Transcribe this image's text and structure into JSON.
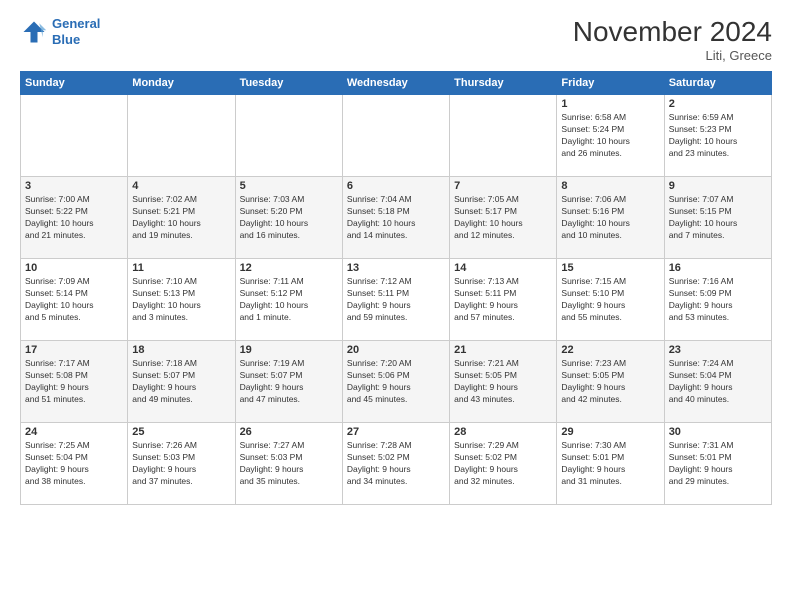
{
  "logo": {
    "line1": "General",
    "line2": "Blue"
  },
  "title": "November 2024",
  "location": "Liti, Greece",
  "days_of_week": [
    "Sunday",
    "Monday",
    "Tuesday",
    "Wednesday",
    "Thursday",
    "Friday",
    "Saturday"
  ],
  "weeks": [
    [
      {
        "day": "",
        "info": ""
      },
      {
        "day": "",
        "info": ""
      },
      {
        "day": "",
        "info": ""
      },
      {
        "day": "",
        "info": ""
      },
      {
        "day": "",
        "info": ""
      },
      {
        "day": "1",
        "info": "Sunrise: 6:58 AM\nSunset: 5:24 PM\nDaylight: 10 hours\nand 26 minutes."
      },
      {
        "day": "2",
        "info": "Sunrise: 6:59 AM\nSunset: 5:23 PM\nDaylight: 10 hours\nand 23 minutes."
      }
    ],
    [
      {
        "day": "3",
        "info": "Sunrise: 7:00 AM\nSunset: 5:22 PM\nDaylight: 10 hours\nand 21 minutes."
      },
      {
        "day": "4",
        "info": "Sunrise: 7:02 AM\nSunset: 5:21 PM\nDaylight: 10 hours\nand 19 minutes."
      },
      {
        "day": "5",
        "info": "Sunrise: 7:03 AM\nSunset: 5:20 PM\nDaylight: 10 hours\nand 16 minutes."
      },
      {
        "day": "6",
        "info": "Sunrise: 7:04 AM\nSunset: 5:18 PM\nDaylight: 10 hours\nand 14 minutes."
      },
      {
        "day": "7",
        "info": "Sunrise: 7:05 AM\nSunset: 5:17 PM\nDaylight: 10 hours\nand 12 minutes."
      },
      {
        "day": "8",
        "info": "Sunrise: 7:06 AM\nSunset: 5:16 PM\nDaylight: 10 hours\nand 10 minutes."
      },
      {
        "day": "9",
        "info": "Sunrise: 7:07 AM\nSunset: 5:15 PM\nDaylight: 10 hours\nand 7 minutes."
      }
    ],
    [
      {
        "day": "10",
        "info": "Sunrise: 7:09 AM\nSunset: 5:14 PM\nDaylight: 10 hours\nand 5 minutes."
      },
      {
        "day": "11",
        "info": "Sunrise: 7:10 AM\nSunset: 5:13 PM\nDaylight: 10 hours\nand 3 minutes."
      },
      {
        "day": "12",
        "info": "Sunrise: 7:11 AM\nSunset: 5:12 PM\nDaylight: 10 hours\nand 1 minute."
      },
      {
        "day": "13",
        "info": "Sunrise: 7:12 AM\nSunset: 5:11 PM\nDaylight: 9 hours\nand 59 minutes."
      },
      {
        "day": "14",
        "info": "Sunrise: 7:13 AM\nSunset: 5:11 PM\nDaylight: 9 hours\nand 57 minutes."
      },
      {
        "day": "15",
        "info": "Sunrise: 7:15 AM\nSunset: 5:10 PM\nDaylight: 9 hours\nand 55 minutes."
      },
      {
        "day": "16",
        "info": "Sunrise: 7:16 AM\nSunset: 5:09 PM\nDaylight: 9 hours\nand 53 minutes."
      }
    ],
    [
      {
        "day": "17",
        "info": "Sunrise: 7:17 AM\nSunset: 5:08 PM\nDaylight: 9 hours\nand 51 minutes."
      },
      {
        "day": "18",
        "info": "Sunrise: 7:18 AM\nSunset: 5:07 PM\nDaylight: 9 hours\nand 49 minutes."
      },
      {
        "day": "19",
        "info": "Sunrise: 7:19 AM\nSunset: 5:07 PM\nDaylight: 9 hours\nand 47 minutes."
      },
      {
        "day": "20",
        "info": "Sunrise: 7:20 AM\nSunset: 5:06 PM\nDaylight: 9 hours\nand 45 minutes."
      },
      {
        "day": "21",
        "info": "Sunrise: 7:21 AM\nSunset: 5:05 PM\nDaylight: 9 hours\nand 43 minutes."
      },
      {
        "day": "22",
        "info": "Sunrise: 7:23 AM\nSunset: 5:05 PM\nDaylight: 9 hours\nand 42 minutes."
      },
      {
        "day": "23",
        "info": "Sunrise: 7:24 AM\nSunset: 5:04 PM\nDaylight: 9 hours\nand 40 minutes."
      }
    ],
    [
      {
        "day": "24",
        "info": "Sunrise: 7:25 AM\nSunset: 5:04 PM\nDaylight: 9 hours\nand 38 minutes."
      },
      {
        "day": "25",
        "info": "Sunrise: 7:26 AM\nSunset: 5:03 PM\nDaylight: 9 hours\nand 37 minutes."
      },
      {
        "day": "26",
        "info": "Sunrise: 7:27 AM\nSunset: 5:03 PM\nDaylight: 9 hours\nand 35 minutes."
      },
      {
        "day": "27",
        "info": "Sunrise: 7:28 AM\nSunset: 5:02 PM\nDaylight: 9 hours\nand 34 minutes."
      },
      {
        "day": "28",
        "info": "Sunrise: 7:29 AM\nSunset: 5:02 PM\nDaylight: 9 hours\nand 32 minutes."
      },
      {
        "day": "29",
        "info": "Sunrise: 7:30 AM\nSunset: 5:01 PM\nDaylight: 9 hours\nand 31 minutes."
      },
      {
        "day": "30",
        "info": "Sunrise: 7:31 AM\nSunset: 5:01 PM\nDaylight: 9 hours\nand 29 minutes."
      }
    ]
  ]
}
